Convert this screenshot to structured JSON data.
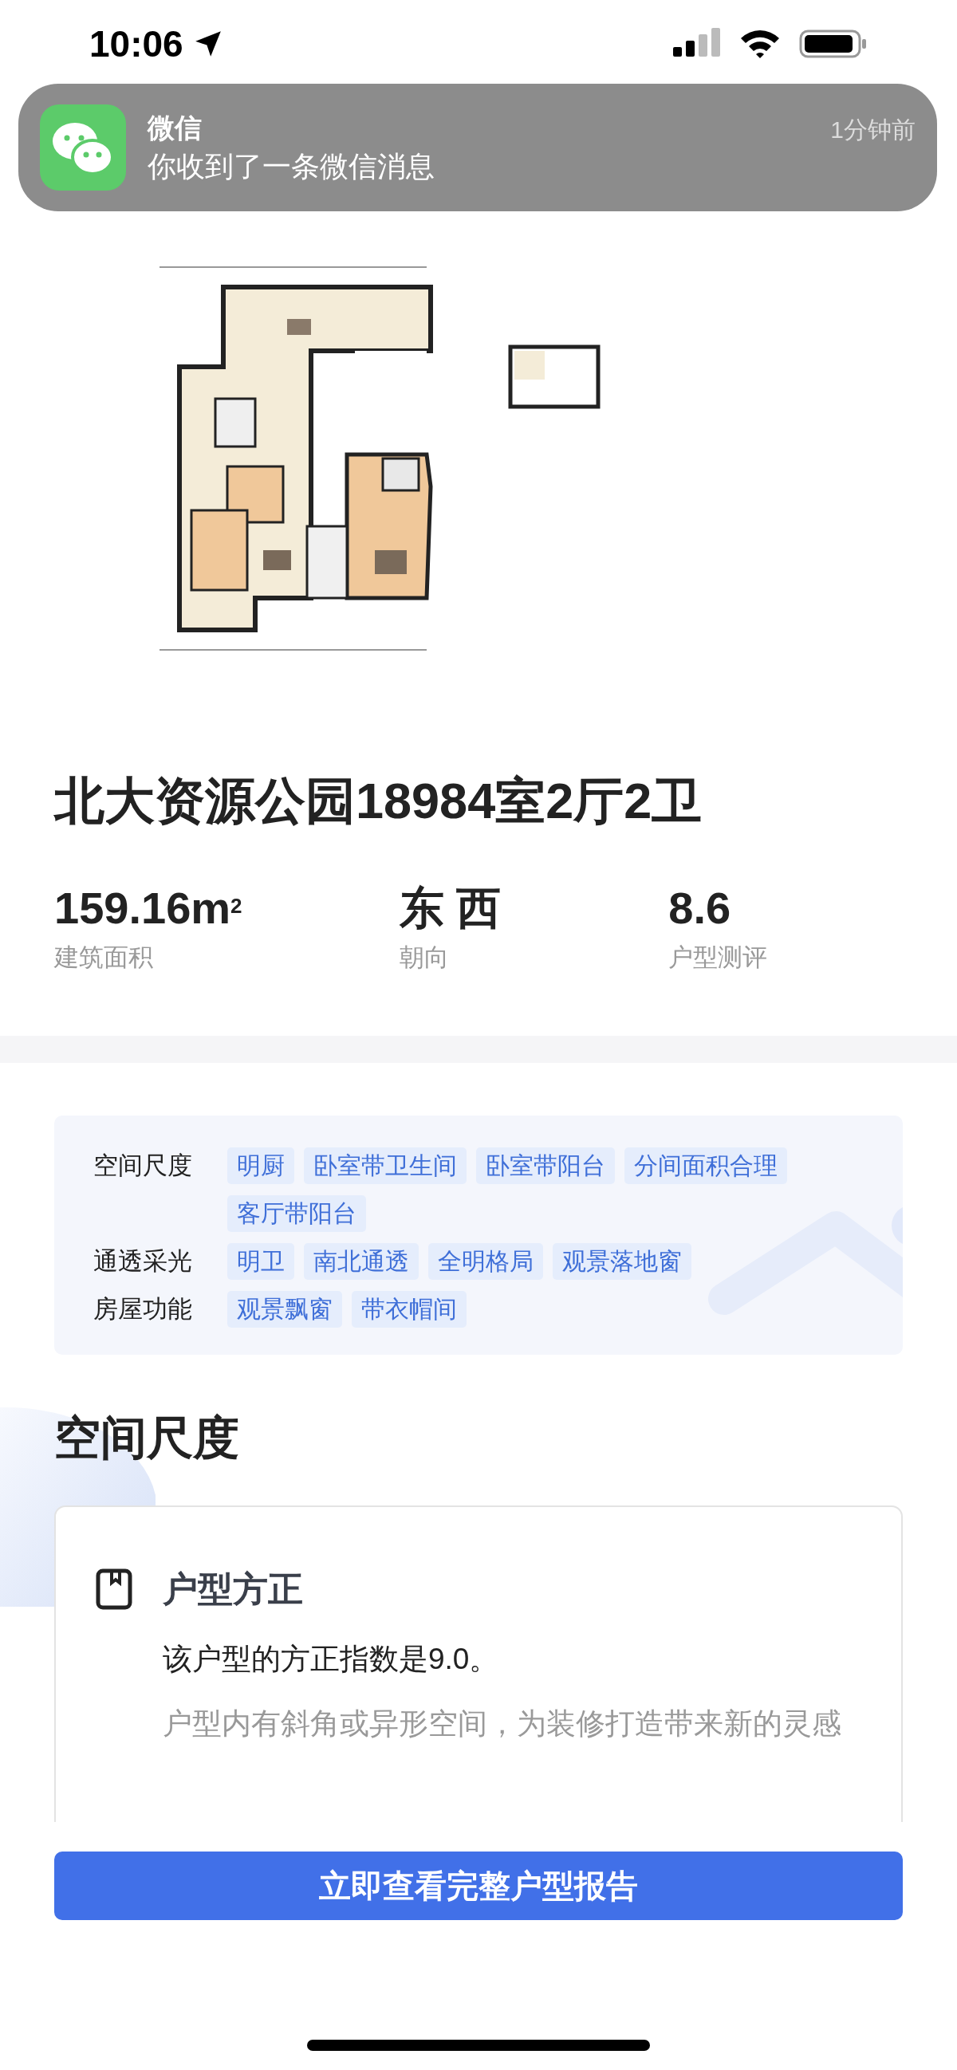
{
  "status_bar": {
    "time": "10:06"
  },
  "notification": {
    "app": "微信",
    "message": "你收到了一条微信消息",
    "time": "1分钟前"
  },
  "title": "北大资源公园18984室2厅2卫",
  "stats": [
    {
      "value": "159.16m$^{2}$",
      "label": "建筑面积"
    },
    {
      "value": "东 西",
      "label": "朝向"
    },
    {
      "value": "8.6",
      "label": "户型测评"
    }
  ],
  "tag_groups": [
    {
      "label": "空间尺度",
      "tags": [
        "明厨",
        "卧室带卫生间",
        "卧室带阳台",
        "分间面积合理",
        "客厅带阳台"
      ]
    },
    {
      "label": "通透采光",
      "tags": [
        "明卫",
        "南北通透",
        "全明格局",
        "观景落地窗"
      ]
    },
    {
      "label": "房屋功能",
      "tags": [
        "观景飘窗",
        "带衣帽间"
      ]
    }
  ],
  "section": {
    "heading": "空间尺度",
    "card": {
      "title": "户型方正",
      "lines": [
        "该户型的方正指数是9.0。",
        "户型内有斜角或异形空间，为装修打造带来新的灵感"
      ]
    }
  },
  "cta_button": "立即查看完整户型报告"
}
